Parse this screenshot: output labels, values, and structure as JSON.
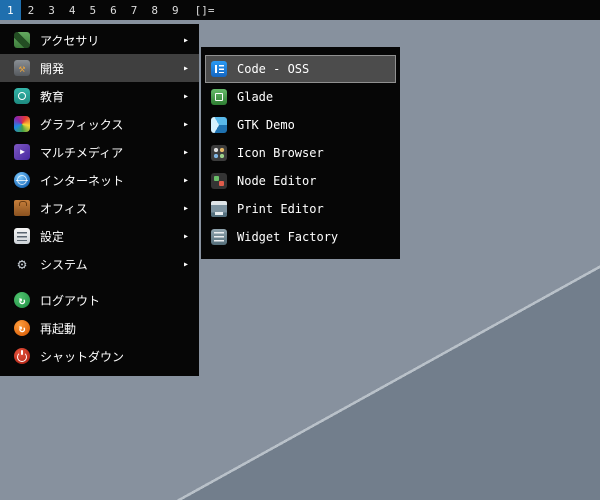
{
  "colors": {
    "selected-tag-bg": "#1f6fae",
    "bar-bg": "#060606",
    "menu-bg": "#060606",
    "menu-highlight-bg": "#3f3f3f",
    "submenu-highlight-bg": "#4c4c4c",
    "submenu-highlight-border": "#909090",
    "wallpaper": "#87919e",
    "wallpaper-dark": "#727e8c",
    "wallpaper-line": "#b9c1c9"
  },
  "taskbar": {
    "tags": [
      "1",
      "2",
      "3",
      "4",
      "5",
      "6",
      "7",
      "8",
      "9"
    ],
    "selected_tag": "1",
    "layout_symbol": "[]="
  },
  "menu": {
    "arrow": "▸",
    "items": [
      {
        "label": "アクセサリ",
        "icon": "accessories-icon",
        "has_submenu": true
      },
      {
        "label": "開発",
        "icon": "development-icon",
        "has_submenu": true,
        "highlighted": true
      },
      {
        "label": "教育",
        "icon": "education-icon",
        "has_submenu": true
      },
      {
        "label": "グラフィックス",
        "icon": "graphics-icon",
        "has_submenu": true
      },
      {
        "label": "マルチメディア",
        "icon": "multimedia-icon",
        "has_submenu": true
      },
      {
        "label": "インターネット",
        "icon": "internet-icon",
        "has_submenu": true
      },
      {
        "label": "オフィス",
        "icon": "office-icon",
        "has_submenu": true
      },
      {
        "label": "設定",
        "icon": "settings-icon",
        "has_submenu": true
      },
      {
        "label": "システム",
        "icon": "system-icon",
        "has_submenu": true
      },
      {
        "label": "ログアウト",
        "icon": "logout-icon",
        "has_submenu": false
      },
      {
        "label": "再起動",
        "icon": "reboot-icon",
        "has_submenu": false
      },
      {
        "label": "シャットダウン",
        "icon": "shutdown-icon",
        "has_submenu": false
      }
    ],
    "submenu": {
      "parent": "開発",
      "items": [
        {
          "label": "Code - OSS",
          "icon": "code-oss-icon",
          "highlighted": true
        },
        {
          "label": "Glade",
          "icon": "glade-icon"
        },
        {
          "label": "GTK Demo",
          "icon": "gtk-demo-icon"
        },
        {
          "label": "Icon Browser",
          "icon": "icon-browser-icon"
        },
        {
          "label": "Node Editor",
          "icon": "node-editor-icon"
        },
        {
          "label": "Print Editor",
          "icon": "print-editor-icon"
        },
        {
          "label": "Widget Factory",
          "icon": "widget-factory-icon"
        }
      ]
    }
  }
}
